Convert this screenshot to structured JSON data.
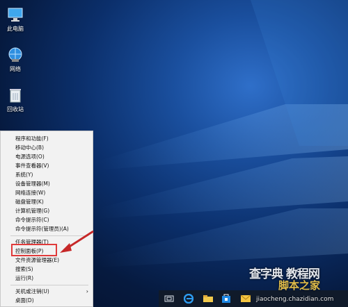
{
  "desktop": {
    "icons": [
      {
        "label": "此电脑",
        "icon": "computer-icon"
      },
      {
        "label": "网络",
        "icon": "network-icon"
      },
      {
        "label": "回收站",
        "icon": "recycle-bin-icon"
      }
    ]
  },
  "winx_menu": {
    "items": [
      "程序和功能(F)",
      "移动中心(B)",
      "电源选项(O)",
      "事件查看器(V)",
      "系统(Y)",
      "设备管理器(M)",
      "网络连接(W)",
      "磁盘管理(K)",
      "计算机管理(G)",
      "命令提示符(C)",
      "命令提示符(管理员)(A)",
      "任务管理器(T)",
      "控制面板(P)",
      "文件资源管理器(E)",
      "搜索(S)",
      "运行(R)",
      "关机或注销(U)",
      "桌面(D)"
    ],
    "highlighted": "控制面板(P)",
    "submenu_chevron": "›"
  },
  "taskbar": {
    "buttons": [
      "task-view-icon",
      "edge-icon",
      "file-explorer-icon",
      "store-icon",
      "mail-icon"
    ]
  },
  "watermark": {
    "line1": "查字典 教程网",
    "line2": "脚本之家",
    "line3": "jiaocheng.chazidian.com"
  },
  "colors": {
    "highlight": "#e03a3a",
    "menu_bg": "#f2f2f2",
    "taskbar_bg": "#101a2a"
  }
}
